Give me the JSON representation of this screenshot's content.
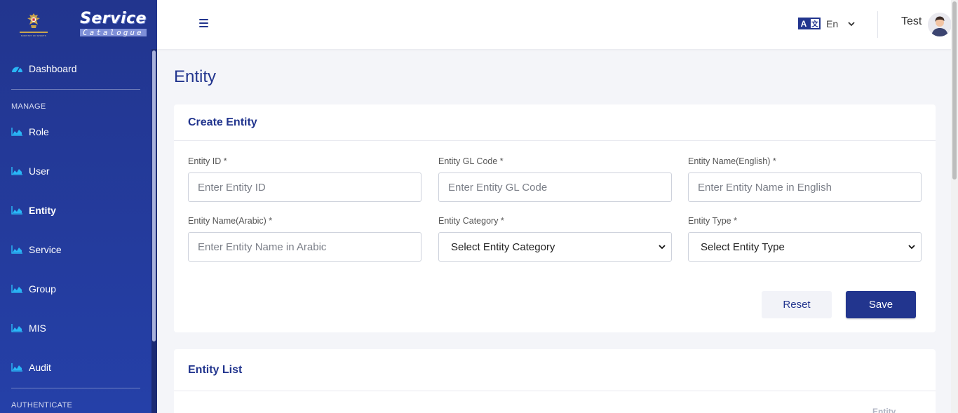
{
  "sidebar": {
    "emblem_caption": "MINISTRY OF SPORTS",
    "brand_title": "Service",
    "brand_subtitle": "Catalogue",
    "dashboard_label": "Dashboard",
    "manage_label": "MANAGE",
    "items": [
      {
        "label": "Role"
      },
      {
        "label": "User"
      },
      {
        "label": "Entity"
      },
      {
        "label": "Service"
      },
      {
        "label": "Group"
      },
      {
        "label": "MIS"
      },
      {
        "label": "Audit"
      }
    ],
    "authenticate_label": "AUTHENTICATE",
    "active_item": "Entity",
    "icon_color": "#29b6f6"
  },
  "header": {
    "menu_icon": "hamburger-icon",
    "lang_icon_a": "A",
    "lang_icon_b": "文",
    "language": "En",
    "user_name": "Test"
  },
  "main": {
    "page_title": "Entity",
    "create_card": {
      "title": "Create Entity",
      "fields": {
        "entity_id": {
          "label": "Entity ID *",
          "placeholder": "Enter Entity ID"
        },
        "gl_code": {
          "label": "Entity GL Code *",
          "placeholder": "Enter Entity GL Code"
        },
        "name_en": {
          "label": "Entity Name(English) *",
          "placeholder": "Enter Entity Name in English"
        },
        "name_ar": {
          "label": "Entity Name(Arabic) *",
          "placeholder": "Enter Entity Name in Arabic"
        },
        "category": {
          "label": "Entity Category *",
          "selected": "Select Entity Category"
        },
        "type": {
          "label": "Entity Type *",
          "selected": "Select Entity Type"
        }
      },
      "reset_label": "Reset",
      "save_label": "Save"
    },
    "list_card": {
      "title": "Entity List",
      "column_header": "Entity"
    }
  },
  "colors": {
    "primary": "#22358e",
    "background": "#f4f5f9"
  }
}
